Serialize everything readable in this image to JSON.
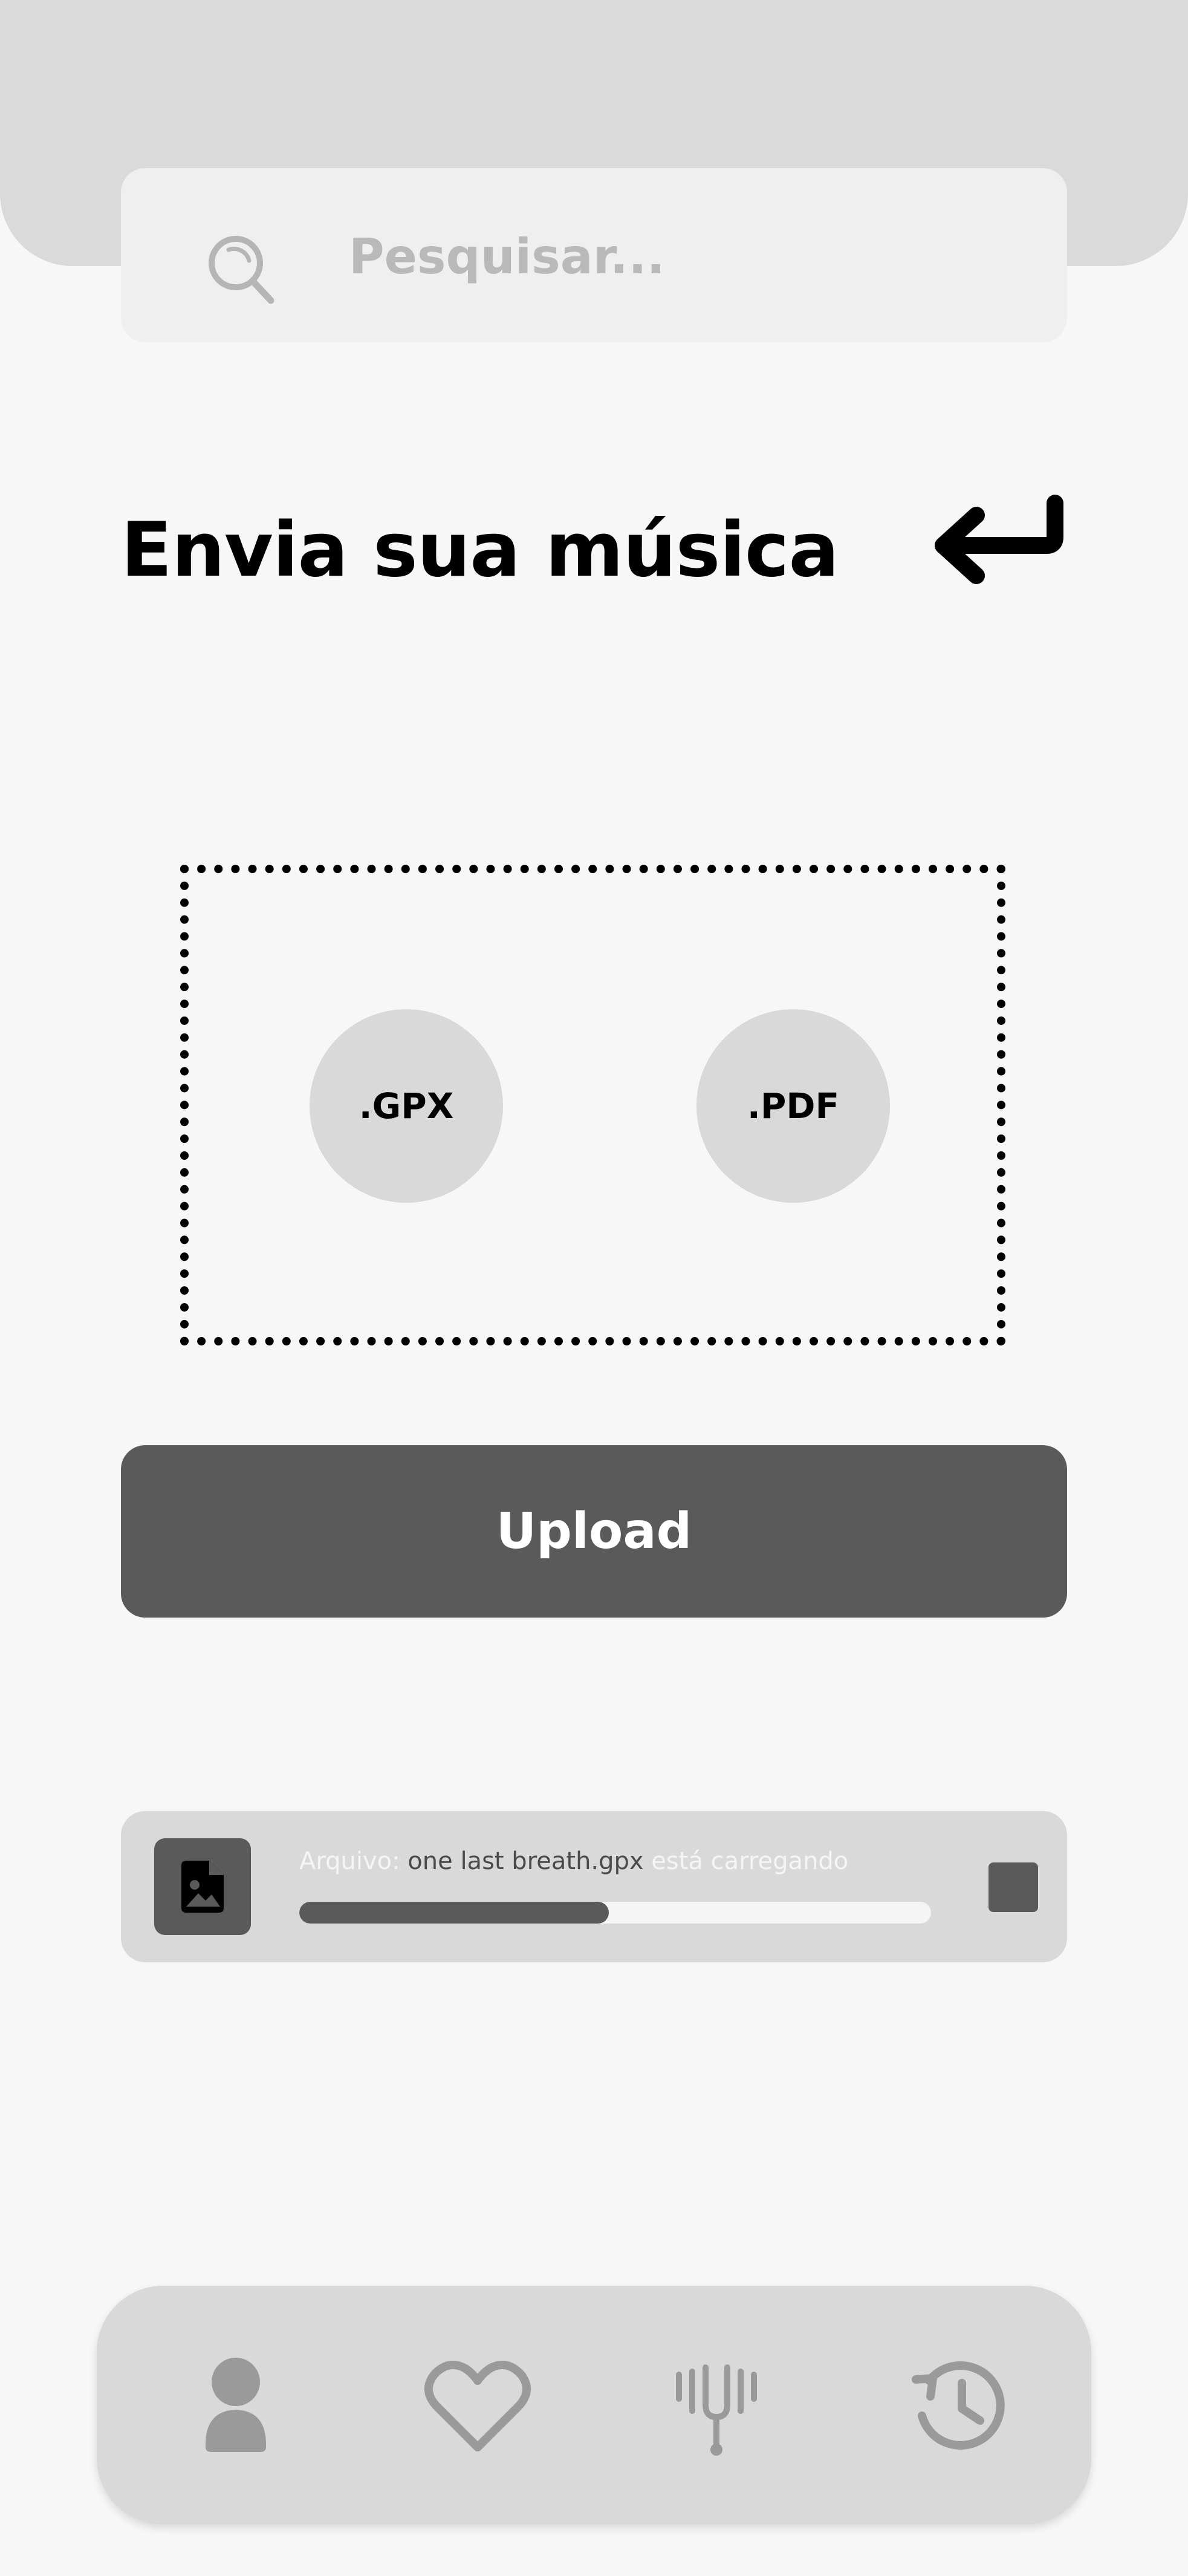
{
  "search": {
    "placeholder": "Pesquisar..."
  },
  "page": {
    "title": "Envia sua música"
  },
  "dropzone": {
    "formats": [
      ".GPX",
      ".PDF"
    ]
  },
  "upload": {
    "button_label": "Upload"
  },
  "upload_status": {
    "prefix": "Arquivo: ",
    "file_name": "one last breath.gpx",
    "suffix": " está carregando",
    "progress": 0.49
  },
  "bottom_nav": {
    "items": [
      {
        "icon": "user-icon"
      },
      {
        "icon": "heart-icon"
      },
      {
        "icon": "tuning-fork-icon"
      },
      {
        "icon": "history-icon"
      }
    ]
  },
  "colors": {
    "background": "#f7f7f7",
    "header": "#dadada",
    "card": "#d9d9d9",
    "accent_dark": "#5a5a5a",
    "icon_gray": "#9a9a9a"
  }
}
